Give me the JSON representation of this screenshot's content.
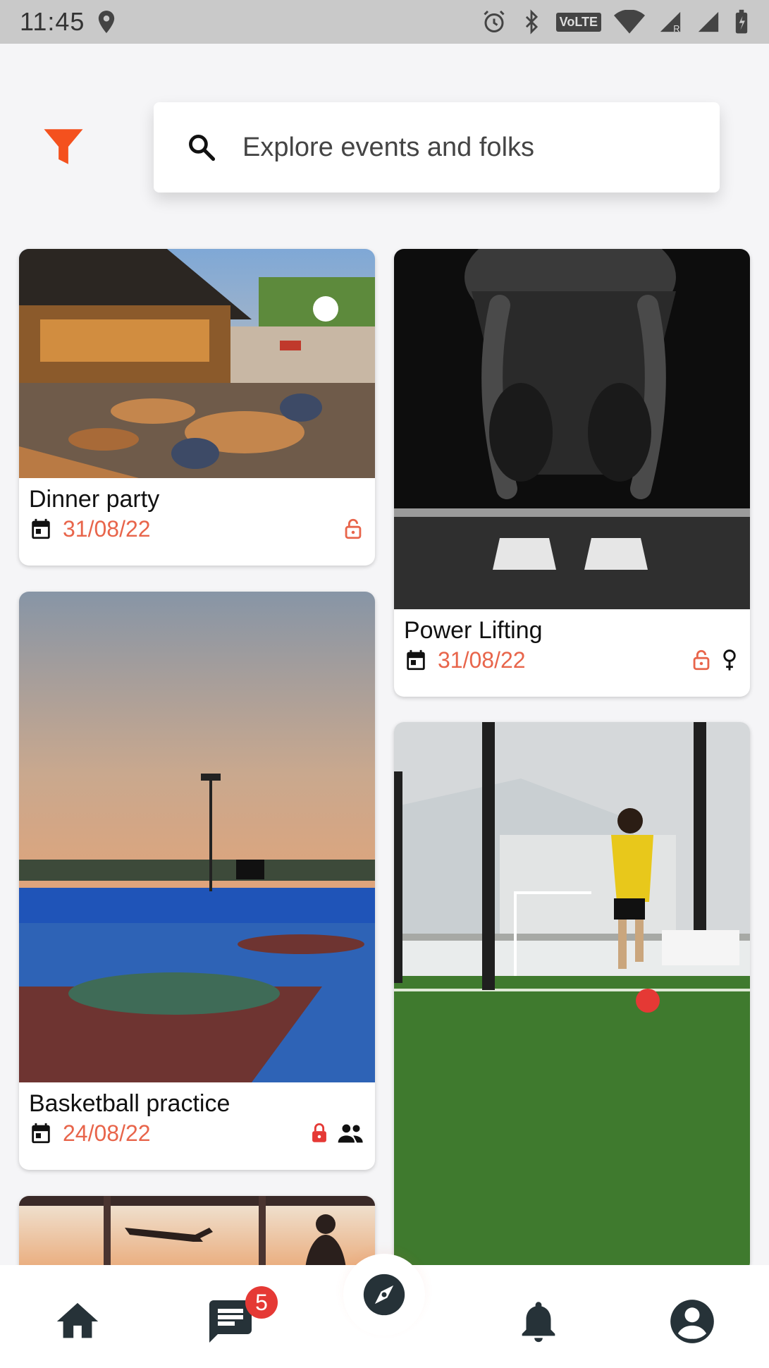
{
  "status_bar": {
    "time": "11:45",
    "network_label": "VoLTE"
  },
  "search": {
    "placeholder": "Explore events and folks"
  },
  "events": [
    {
      "title": "Dinner party",
      "date": "31/08/22",
      "badges": [
        "lock-open-icon"
      ]
    },
    {
      "title": "Power Lifting",
      "date": "31/08/22",
      "badges": [
        "lock-open-icon",
        "female-icon"
      ]
    },
    {
      "title": "Basketball practice",
      "date": "24/08/22",
      "badges": [
        "lock-closed-icon",
        "group-icon"
      ]
    },
    {
      "title": "",
      "date": "",
      "badges": []
    },
    {
      "title": "",
      "date": "",
      "badges": []
    }
  ],
  "nav": {
    "items": [
      "home-icon",
      "chat-icon",
      "explore-icon",
      "notifications-icon",
      "profile-icon"
    ],
    "chat_badge": "5"
  },
  "colors": {
    "accent": "#e8654b",
    "filter": "#f4511e",
    "nav_icon": "#263238"
  }
}
